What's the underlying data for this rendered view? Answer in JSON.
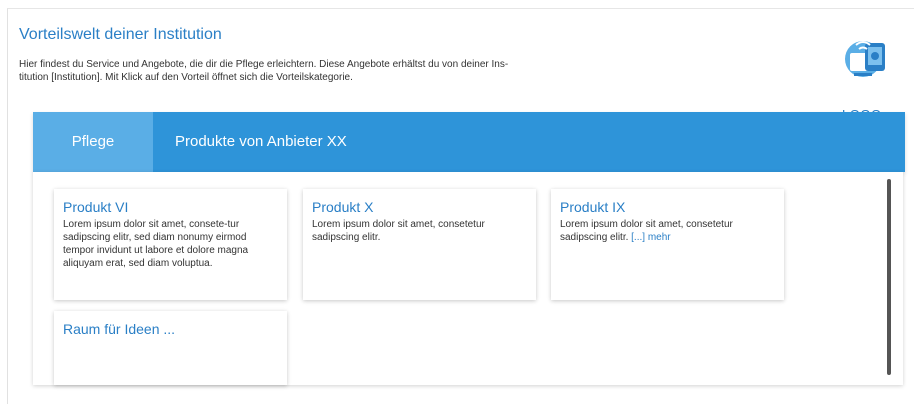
{
  "header": {
    "title": "Vorteilswelt deiner Institution",
    "intro_line1": "Hier findest du Service und Angebote, die dir die Pflege erleichtern. Diese Angebote erhältst du von deiner Ins-",
    "intro_line2": "titution [Institution]. Mit Klick auf den Vorteil öffnet sich die Vorteilskategorie.",
    "logo_text": "LOGO"
  },
  "tabs": [
    {
      "label": "Pflege",
      "active": true
    },
    {
      "label": "Produkte von Anbieter XX",
      "active": false
    }
  ],
  "cards": [
    {
      "title": "Produkt VI",
      "text": "Lorem ipsum dolor sit amet, consete-tur sadipscing elitr, sed diam nonumy eirmod tempor invidunt ut labore et dolore magna aliquyam erat, sed diam voluptua."
    },
    {
      "title": "Produkt X",
      "text": "Lorem ipsum dolor sit amet, consetetur sadipscing elitr."
    },
    {
      "title": "Produkt IX",
      "text": "Lorem ipsum dolor sit amet, consetetur sadipscing elitr.",
      "more": "[...] mehr"
    },
    {
      "title": "Raum für Ideen ...",
      "text": ""
    }
  ],
  "colors": {
    "accent": "#2a7fc6",
    "tabbar": "#2e94d9",
    "tab_active": "#5aaee6"
  }
}
